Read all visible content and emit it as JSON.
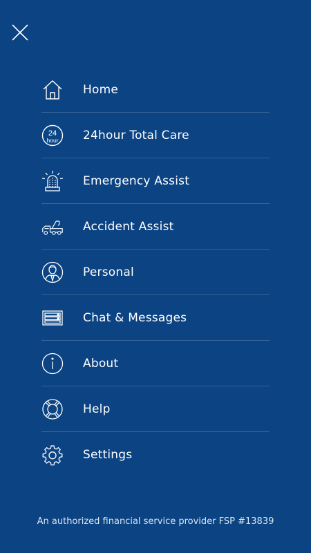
{
  "menu": {
    "items": [
      {
        "label": "Home",
        "icon": "home-icon"
      },
      {
        "label": "24hour Total Care",
        "icon": "24-hour-icon"
      },
      {
        "label": "Emergency Assist",
        "icon": "emergency-siren-icon"
      },
      {
        "label": "Accident Assist",
        "icon": "tow-truck-icon"
      },
      {
        "label": "Personal",
        "icon": "person-icon"
      },
      {
        "label": "Chat & Messages",
        "icon": "chat-messages-icon"
      },
      {
        "label": "About",
        "icon": "info-icon"
      },
      {
        "label": "Help",
        "icon": "lifebuoy-icon"
      },
      {
        "label": "Settings",
        "icon": "gear-icon"
      }
    ]
  },
  "icon_labels": {
    "hour_24_top": "24",
    "hour_24_bottom": "hour"
  },
  "footer": {
    "text": "An authorized financial service provider FSP #13839"
  },
  "colors": {
    "background": "#0b4383",
    "foreground": "#ffffff",
    "divider": "rgba(255,255,255,0.18)"
  }
}
